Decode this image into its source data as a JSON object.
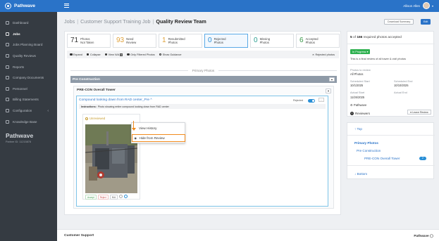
{
  "app": {
    "brand": "Pathwave",
    "user_name": "Allison Allen"
  },
  "sidebar": {
    "items": [
      {
        "label": "Dashboard",
        "active": false
      },
      {
        "label": "Jobs",
        "active": true
      },
      {
        "label": "Jobs Planning Board",
        "active": false
      },
      {
        "label": "Quality Reviews",
        "active": false
      },
      {
        "label": "Reports",
        "active": false
      },
      {
        "label": "Company Documents",
        "active": false
      },
      {
        "label": "Personnel",
        "active": false
      },
      {
        "label": "Billing Statements",
        "active": false
      },
      {
        "label": "Configuration",
        "active": false
      },
      {
        "label": "Knowledge Base",
        "active": false
      }
    ],
    "org_name": "Pathwave",
    "partner_id": "Partner ID: 11215878"
  },
  "breadcrumb": {
    "jobs": "Jobs",
    "sep": "|",
    "job": "Customer Support Training Job",
    "current": "Quality Review Team"
  },
  "header": {
    "download_label": "Download Summary",
    "edit_label": "Edit"
  },
  "stats": [
    {
      "num": "71",
      "line1": "Photos",
      "line2": "Not Taken",
      "color": "#333333"
    },
    {
      "num": "93",
      "line1": "Need",
      "line2": "Review",
      "color": "#e0a23a"
    },
    {
      "num": "1",
      "line1": "Resubmitted",
      "line2": "Photos",
      "color": "#e0a23a"
    },
    {
      "num": "0",
      "line1": "Rejected",
      "line2": "Photos",
      "color": "#2a8fd6"
    },
    {
      "num": "0",
      "line1": "Missing",
      "line2": "Photos",
      "color": "#2a9d8f"
    },
    {
      "num": "6",
      "line1": "Accepted",
      "line2": "Photos",
      "color": "#3a9a4a"
    }
  ],
  "toolbar": {
    "expand": "Expand",
    "collapse": "Collapse",
    "view_na": "View N/A",
    "view_na_count": "0",
    "only_filtered": "Only Filtered Photos",
    "show_guidance": "Show Guidance",
    "rejected_photos": "Rejected photos"
  },
  "main": {
    "primary_label": "Primary Photos",
    "section": "Pre Construction",
    "subsection": "PRE-CON Overall Tower",
    "photo_title": "Compound looking down from RAD center_Pre",
    "photo_title_caret": "^",
    "rejected_label": "Rejected",
    "more_label": "...",
    "instructions_label": "Instructions:",
    "instructions_text": "Photo showing entire compound looking down from RAD center",
    "unreviewed": "Unreviewed",
    "accept": "Accept",
    "reject": "Reject",
    "na": "N/A"
  },
  "menu": {
    "view_history": "View History",
    "hide_from_review": "Hide from Review"
  },
  "right_panel": {
    "req_count": "5",
    "req_total": "166",
    "req_text_pre": " of ",
    "req_text_post": " required photos accepted",
    "status": "In Progress",
    "note": "This is a final review of all tower & civil photos",
    "photos_to_review_label": "Photos to review",
    "photos_to_review_val": "All Photos",
    "sched_start_label": "Scheduled Start",
    "sched_start_val": "10/1/2025",
    "sched_end_label": "Scheduled End",
    "sched_end_val": "10/10/2025",
    "actual_start_label": "Actual Start",
    "actual_start_val": "11/26/2025",
    "actual_end_label": "Actual End",
    "company": "Pathwave",
    "reviewers_count": "1",
    "reviewers_label": "Reviewers",
    "leave_review": "Leave Review"
  },
  "outline": {
    "top": "Top",
    "primary": "Primary Photos",
    "pre_con": "Pre Construction",
    "tower": "PRE-CON Overall Tower",
    "tower_count": "2",
    "bottom": "Bottom"
  },
  "footer": {
    "left": "Customer Support",
    "right": "Pathwave"
  }
}
